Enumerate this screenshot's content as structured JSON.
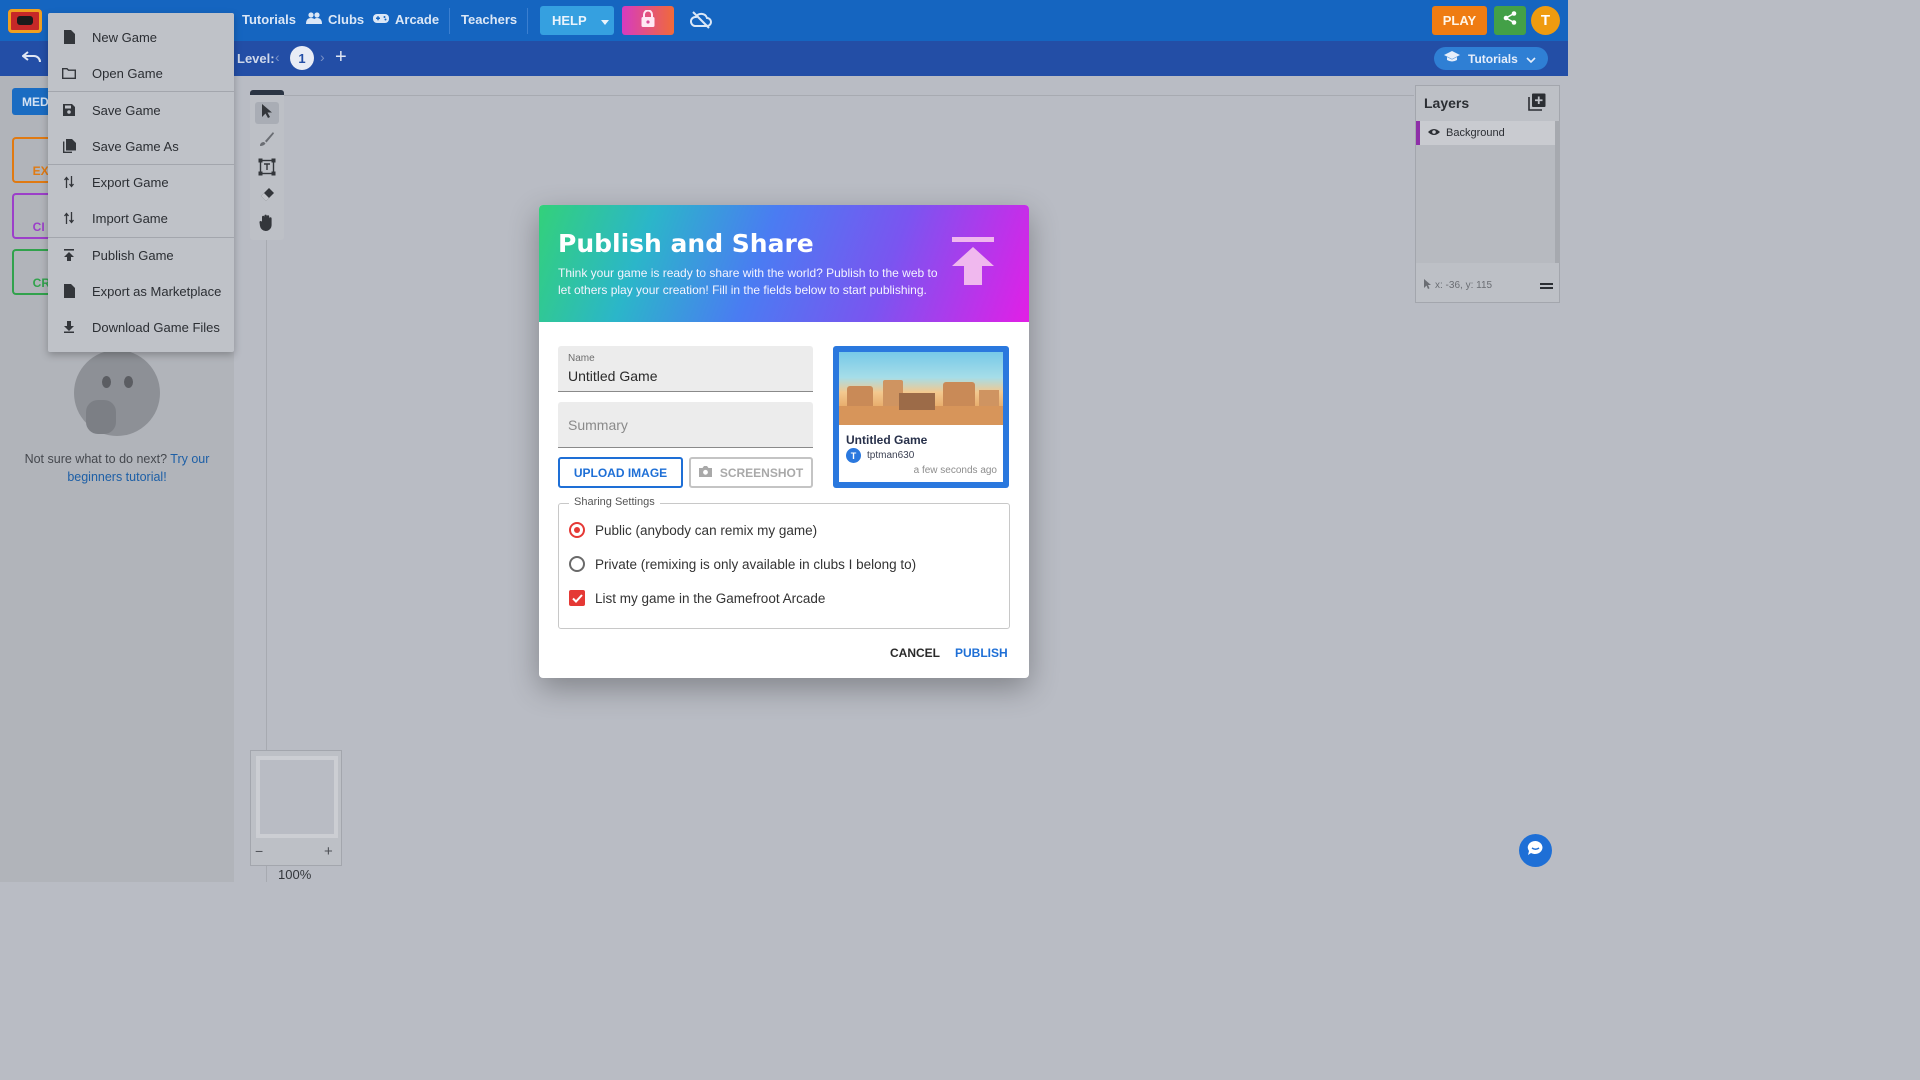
{
  "topbar": {
    "nav": [
      {
        "label": "Tutorials",
        "icon": "school-icon"
      },
      {
        "label": "Clubs",
        "icon": "people-icon"
      },
      {
        "label": "Arcade",
        "icon": "gamepad-icon"
      },
      {
        "label": "Teachers",
        "icon": ""
      }
    ],
    "help_label": "HELP",
    "play_label": "PLAY",
    "user_initial": "T"
  },
  "subbar": {
    "level_label": "Level:",
    "level_number": "1",
    "tutorials_label": "Tutorials"
  },
  "left_panel": {
    "media_tab_label": "MED",
    "cards": [
      {
        "text": "EX\nM",
        "color": "#e07a12"
      },
      {
        "text": "CI\nAN",
        "color": "#9c3fc9"
      },
      {
        "text": "CRE\nE",
        "color": "#31a24c"
      }
    ],
    "hint_text": "Not sure what to do next?",
    "hint_link": "Try our beginners tutorial!"
  },
  "file_menu": {
    "items": [
      {
        "label": "New Game",
        "icon": "file-icon"
      },
      {
        "label": "Open Game",
        "icon": "folder-icon"
      },
      {
        "label": "Save Game",
        "icon": "save-icon"
      },
      {
        "label": "Save Game As",
        "icon": "copy-icon"
      },
      {
        "label": "Export Game",
        "icon": "swap-icon"
      },
      {
        "label": "Import Game",
        "icon": "swap-icon"
      },
      {
        "label": "Publish Game",
        "icon": "publish-icon"
      },
      {
        "label": "Export as Marketplace",
        "icon": "file-icon"
      },
      {
        "label": "Download Game Files",
        "icon": "download-icon"
      }
    ]
  },
  "canvas": {
    "zoom_level": "100%",
    "zoom_out": "−",
    "zoom_in": "+"
  },
  "layers": {
    "title": "Layers",
    "items": [
      {
        "name": "Background",
        "icon": "eye-icon"
      }
    ],
    "coords": "x: -36, y: 115"
  },
  "dialog": {
    "title": "Publish and Share",
    "description": "Think your game is ready to share with the world? Publish to the web to let others play your creation! Fill in the fields below to start publishing.",
    "name_field": {
      "label": "Name",
      "value": "Untitled Game"
    },
    "summary_field": {
      "placeholder": "Summary",
      "value": ""
    },
    "upload_button": "UPLOAD IMAGE",
    "screenshot_button": "SCREENSHOT",
    "preview": {
      "title": "Untitled Game",
      "username": "tptman630",
      "user_initial": "T",
      "time": "a few seconds ago"
    },
    "sharing": {
      "legend": "Sharing Settings",
      "public_label": "Public (anybody can remix my game)",
      "private_label": "Private (remixing is only available in clubs I belong to)",
      "arcade_label": "List my game in the Gamefroot Arcade",
      "selected": "public",
      "list_in_arcade": true
    },
    "cancel_label": "CANCEL",
    "publish_label": "PUBLISH"
  },
  "colors": {
    "topbar": "#1565c0",
    "subbar": "#234ea6",
    "accent_blue": "#1e6fd6",
    "accent_red": "#e53935",
    "play": "#ef7c12",
    "share": "#43a047"
  }
}
